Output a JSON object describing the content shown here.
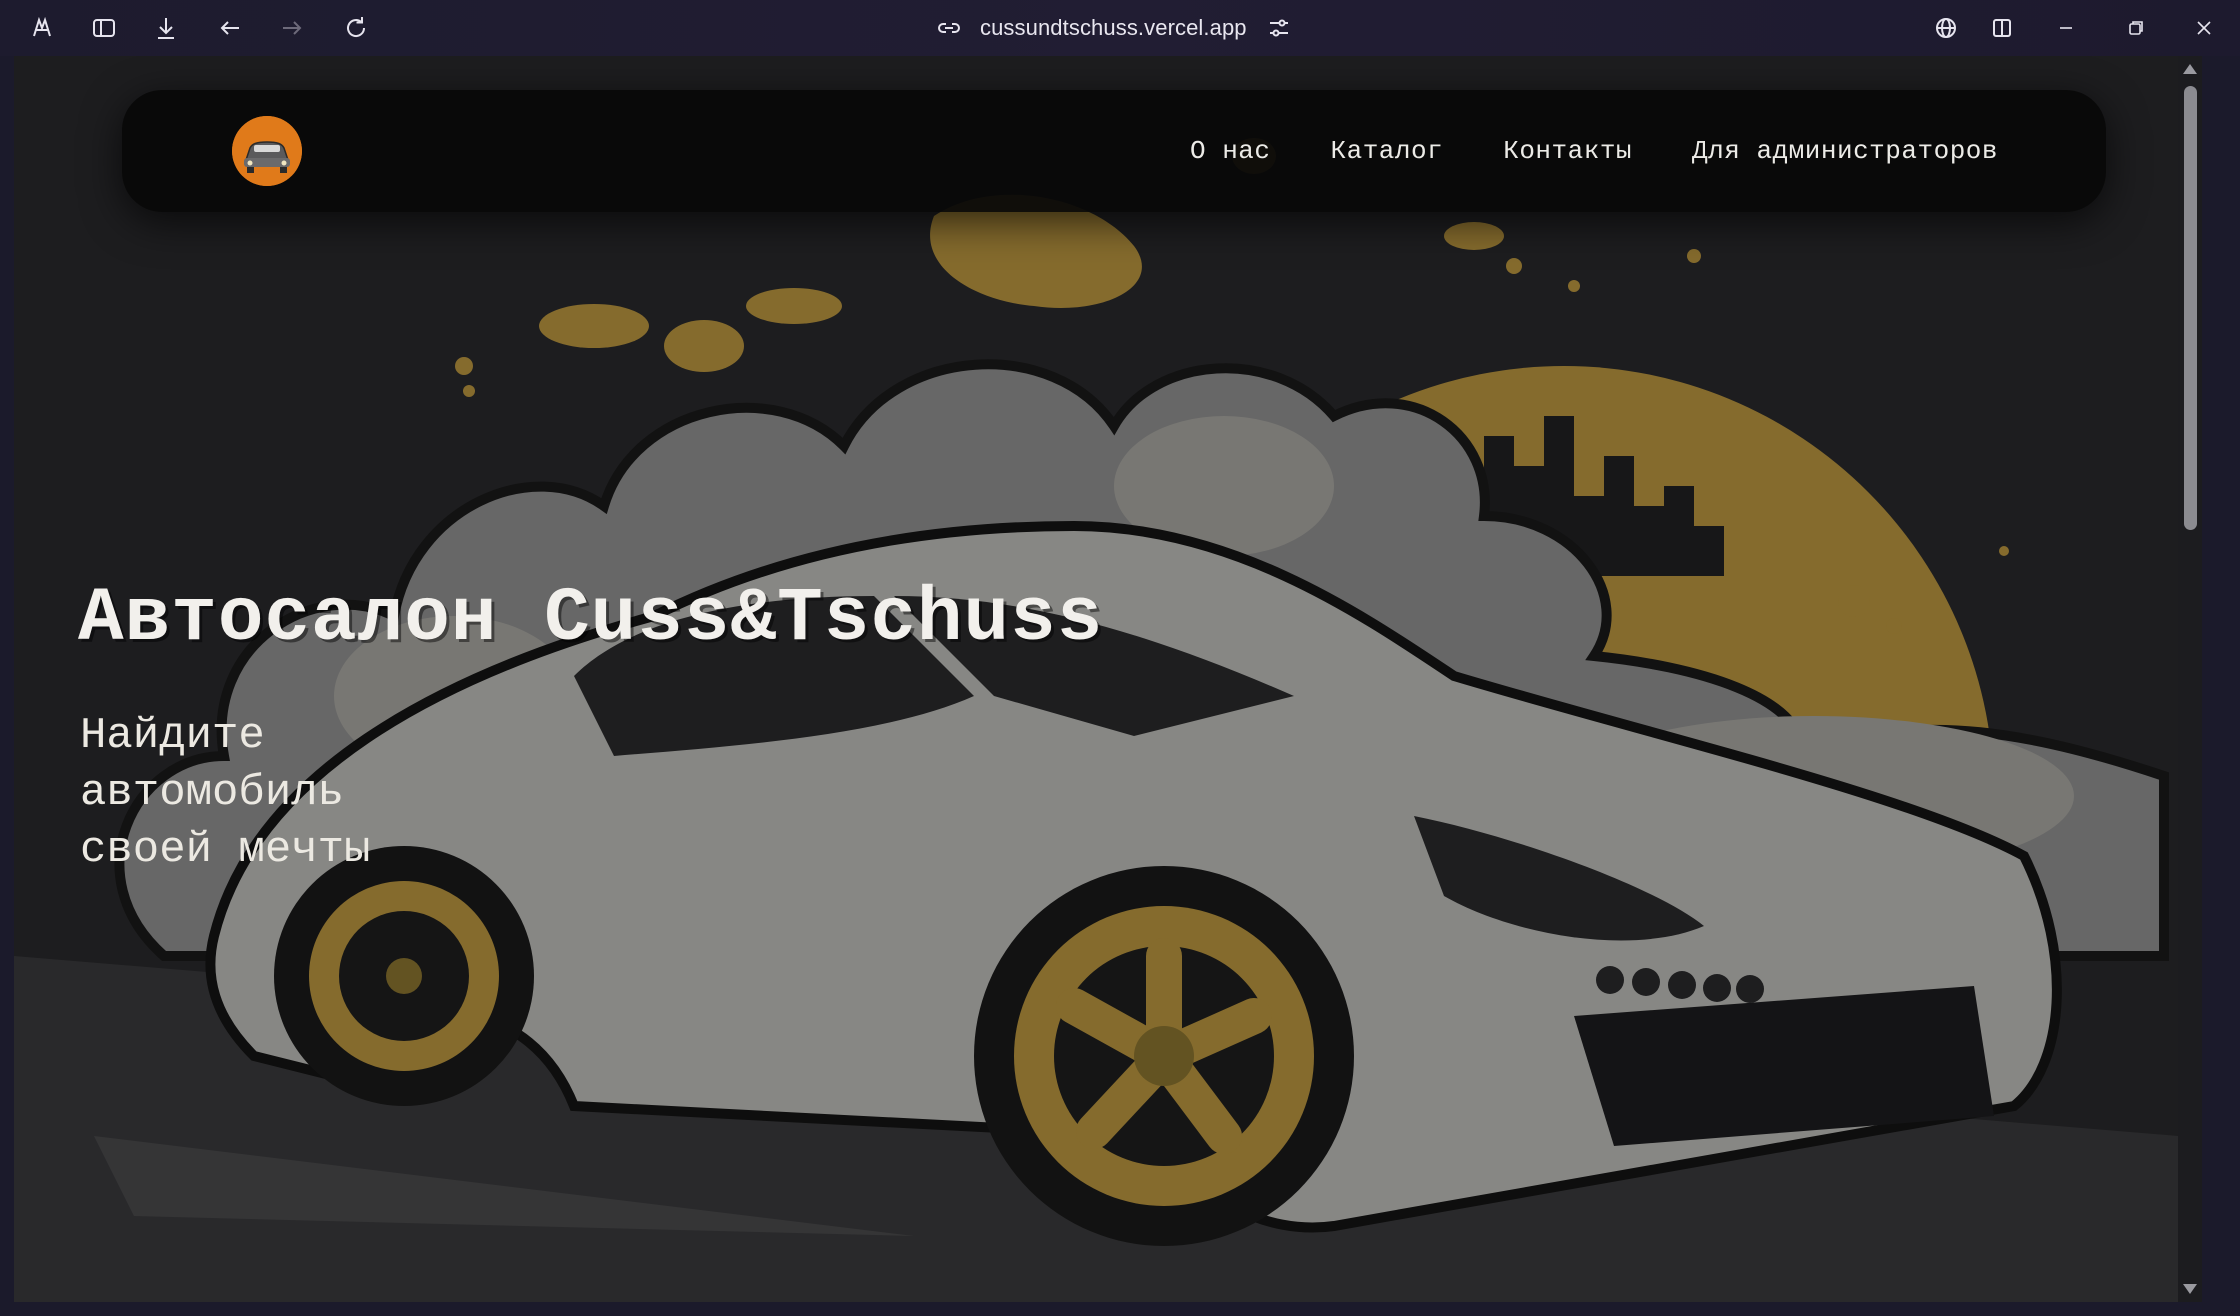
{
  "browser": {
    "url": "cussundtschuss.vercel.app"
  },
  "navbar": {
    "logo_icon": "car-logo-icon",
    "links": [
      "О нас",
      "Каталог",
      "Контакты",
      "Для администраторов"
    ]
  },
  "hero": {
    "title": "Автосалон Cuss&Tschuss",
    "subtitle": "Найдите автомобиль своей мечты"
  },
  "colors": {
    "accent_gold": "#b9953f",
    "navbar_bg": "#080808",
    "logo_orange": "#e07a1a"
  }
}
